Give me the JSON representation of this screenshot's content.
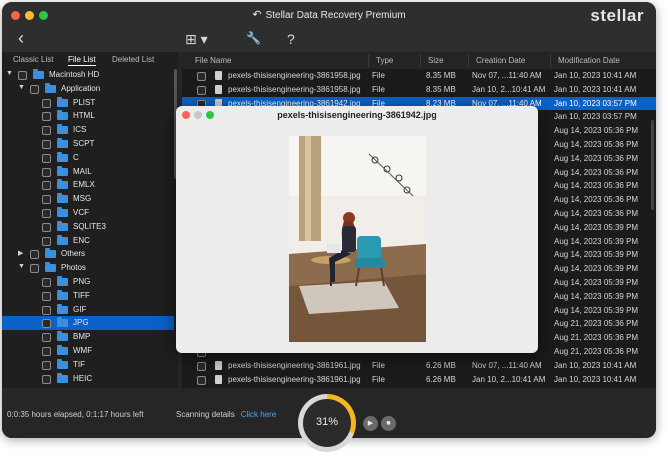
{
  "window": {
    "title": "Stellar Data Recovery Premium",
    "brand": "stellar"
  },
  "toolbar": {
    "back": "‹",
    "view": "⊞ ▾",
    "tools": "🔧",
    "help": "?"
  },
  "sidebar": {
    "tabs": [
      {
        "label": "Classic List",
        "active": false
      },
      {
        "label": "File List",
        "active": true
      },
      {
        "label": "Deleted List",
        "active": false
      }
    ],
    "tree": [
      {
        "label": "Macintosh HD",
        "level": 0,
        "arrow": "▼",
        "selected": false
      },
      {
        "label": "Application",
        "level": 1,
        "arrow": "▼",
        "selected": false
      },
      {
        "label": "PLIST",
        "level": 2,
        "arrow": "",
        "selected": false
      },
      {
        "label": "HTML",
        "level": 2,
        "arrow": "",
        "selected": false
      },
      {
        "label": "ICS",
        "level": 2,
        "arrow": "",
        "selected": false
      },
      {
        "label": "SCPT",
        "level": 2,
        "arrow": "",
        "selected": false
      },
      {
        "label": "C",
        "level": 2,
        "arrow": "",
        "selected": false
      },
      {
        "label": "MAIL",
        "level": 2,
        "arrow": "",
        "selected": false
      },
      {
        "label": "EMLX",
        "level": 2,
        "arrow": "",
        "selected": false
      },
      {
        "label": "MSG",
        "level": 2,
        "arrow": "",
        "selected": false
      },
      {
        "label": "VCF",
        "level": 2,
        "arrow": "",
        "selected": false
      },
      {
        "label": "SQLITE3",
        "level": 2,
        "arrow": "",
        "selected": false
      },
      {
        "label": "ENC",
        "level": 2,
        "arrow": "",
        "selected": false
      },
      {
        "label": "Others",
        "level": 1,
        "arrow": "▶",
        "selected": false
      },
      {
        "label": "Photos",
        "level": 1,
        "arrow": "▼",
        "selected": false
      },
      {
        "label": "PNG",
        "level": 2,
        "arrow": "",
        "selected": false
      },
      {
        "label": "TIFF",
        "level": 2,
        "arrow": "",
        "selected": false
      },
      {
        "label": "GIF",
        "level": 2,
        "arrow": "",
        "selected": false
      },
      {
        "label": "JPG",
        "level": 2,
        "arrow": "",
        "selected": true
      },
      {
        "label": "BMP",
        "level": 2,
        "arrow": "",
        "selected": false
      },
      {
        "label": "WMF",
        "level": 2,
        "arrow": "",
        "selected": false
      },
      {
        "label": "TIF",
        "level": 2,
        "arrow": "",
        "selected": false
      },
      {
        "label": "HEIC",
        "level": 2,
        "arrow": "",
        "selected": false
      }
    ]
  },
  "filelist": {
    "headers": [
      "File Name",
      "Type",
      "Size",
      "Creation Date",
      "Modification Date"
    ],
    "rows": [
      {
        "name": "pexels-thisisengineering-3861958.jpg",
        "type": "File",
        "size": "8.35 MB",
        "created": "Nov 07, ...11:40 AM",
        "modified": "Jan 10, 2023 10:41 AM",
        "selected": false
      },
      {
        "name": "pexels-thisisengineering-3861958.jpg",
        "type": "File",
        "size": "8.35 MB",
        "created": "Jan 10, 2...10:41 AM",
        "modified": "Jan 10, 2023 10:41 AM",
        "selected": false
      },
      {
        "name": "pexels-thisisengineering-3861942.jpg",
        "type": "File",
        "size": "8.23 MB",
        "created": "Nov 07, ...11:40 AM",
        "modified": "Jan 10, 2023 03:57 PM",
        "selected": true
      },
      {
        "name": "",
        "type": "",
        "size": "",
        "created": "",
        "modified": "Jan 10, 2023 03:57 PM",
        "selected": false
      },
      {
        "name": "",
        "type": "",
        "size": "",
        "created": "",
        "modified": "Aug 14, 2023 05:36 PM",
        "selected": false
      },
      {
        "name": "",
        "type": "",
        "size": "",
        "created": "",
        "modified": "Aug 14, 2023 05:36 PM",
        "selected": false
      },
      {
        "name": "",
        "type": "",
        "size": "",
        "created": "",
        "modified": "Aug 14, 2023 05:36 PM",
        "selected": false
      },
      {
        "name": "",
        "type": "",
        "size": "",
        "created": "",
        "modified": "Aug 14, 2023 05:36 PM",
        "selected": false
      },
      {
        "name": "",
        "type": "",
        "size": "",
        "created": "",
        "modified": "Aug 14, 2023 05:36 PM",
        "selected": false
      },
      {
        "name": "",
        "type": "",
        "size": "",
        "created": "",
        "modified": "Aug 14, 2023 05:36 PM",
        "selected": false
      },
      {
        "name": "",
        "type": "",
        "size": "",
        "created": "",
        "modified": "Aug 14, 2023 05:36 PM",
        "selected": false
      },
      {
        "name": "",
        "type": "",
        "size": "",
        "created": "",
        "modified": "Aug 14, 2023 05:39 PM",
        "selected": false
      },
      {
        "name": "",
        "type": "",
        "size": "",
        "created": "",
        "modified": "Aug 14, 2023 05:39 PM",
        "selected": false
      },
      {
        "name": "",
        "type": "",
        "size": "",
        "created": "",
        "modified": "Aug 14, 2023 05:39 PM",
        "selected": false
      },
      {
        "name": "",
        "type": "",
        "size": "",
        "created": "",
        "modified": "Aug 14, 2023 05:39 PM",
        "selected": false
      },
      {
        "name": "",
        "type": "",
        "size": "",
        "created": "",
        "modified": "Aug 14, 2023 05:39 PM",
        "selected": false
      },
      {
        "name": "",
        "type": "",
        "size": "",
        "created": "",
        "modified": "Aug 14, 2023 05:39 PM",
        "selected": false
      },
      {
        "name": "",
        "type": "",
        "size": "",
        "created": "",
        "modified": "Aug 14, 2023 05:39 PM",
        "selected": false
      },
      {
        "name": "",
        "type": "",
        "size": "",
        "created": "",
        "modified": "Aug 21, 2023 05:36 PM",
        "selected": false
      },
      {
        "name": "",
        "type": "",
        "size": "",
        "created": "",
        "modified": "Aug 21, 2023 05:36 PM",
        "selected": false
      },
      {
        "name": "",
        "type": "",
        "size": "",
        "created": "",
        "modified": "Aug 21, 2023 05:36 PM",
        "selected": false
      },
      {
        "name": "pexels-thisisengineering-3861961.jpg",
        "type": "File",
        "size": "6.26 MB",
        "created": "Nov 07, ...11:40 AM",
        "modified": "Jan 10, 2023 10:41 AM",
        "selected": false
      },
      {
        "name": "pexels-thisisengineering-3861961.jpg",
        "type": "File",
        "size": "6.26 MB",
        "created": "Jan 10, 2...10:41 AM",
        "modified": "Jan 10, 2023 10:41 AM",
        "selected": false
      }
    ]
  },
  "preview": {
    "title": "pexels-thisisengineering-3861942.jpg"
  },
  "footer": {
    "elapsed": "0:0:35 hours elapsed, 0:1:17 hours left",
    "scanning_label": "Scanning details",
    "scanning_link": "Click here",
    "progress_pct": 31,
    "progress_text": "31%",
    "play": "▶",
    "stop": "■"
  },
  "colors": {
    "accent": "#0a62c9",
    "progress": "#f5b721",
    "link": "#4ea6ff"
  }
}
